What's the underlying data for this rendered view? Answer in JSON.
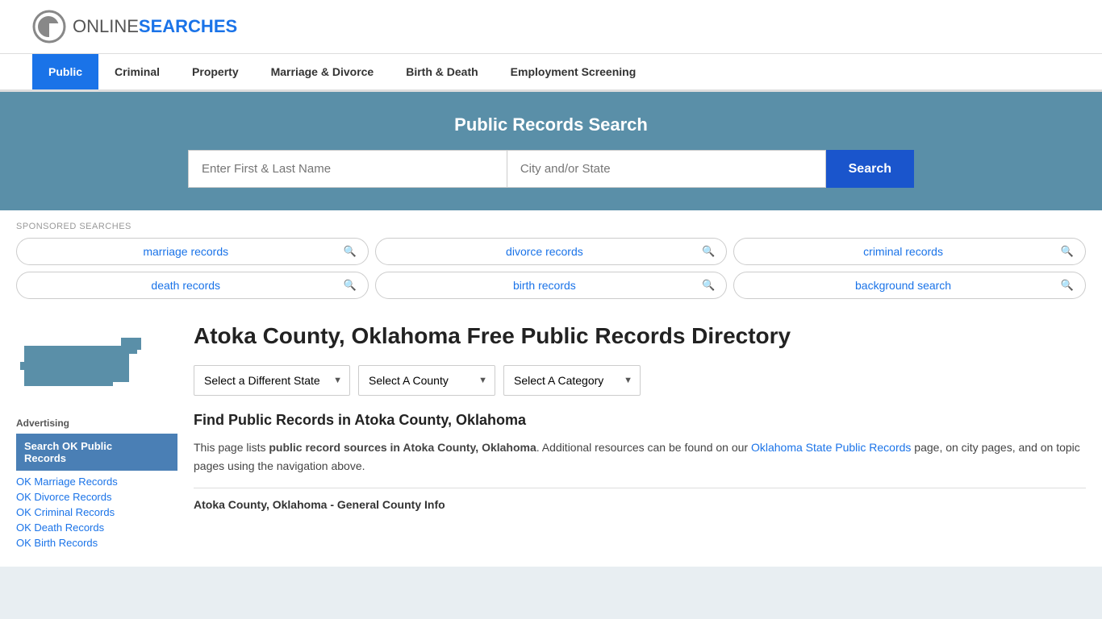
{
  "site": {
    "logo_text_normal": "ONLINE",
    "logo_text_bold": "SEARCHES"
  },
  "nav": {
    "items": [
      {
        "label": "Public",
        "active": true
      },
      {
        "label": "Criminal",
        "active": false
      },
      {
        "label": "Property",
        "active": false
      },
      {
        "label": "Marriage & Divorce",
        "active": false
      },
      {
        "label": "Birth & Death",
        "active": false
      },
      {
        "label": "Employment Screening",
        "active": false
      }
    ]
  },
  "hero": {
    "title": "Public Records Search",
    "name_placeholder": "Enter First & Last Name",
    "location_placeholder": "City and/or State",
    "search_button": "Search"
  },
  "sponsored": {
    "label": "SPONSORED SEARCHES",
    "items": [
      {
        "text": "marriage records"
      },
      {
        "text": "divorce records"
      },
      {
        "text": "criminal records"
      },
      {
        "text": "death records"
      },
      {
        "text": "birth records"
      },
      {
        "text": "background search"
      }
    ]
  },
  "page": {
    "title": "Atoka County, Oklahoma Free Public Records Directory",
    "selects": {
      "state": {
        "label": "Select a Different State",
        "options": [
          "Select a Different State"
        ]
      },
      "county": {
        "label": "Select A County",
        "options": [
          "Select A County"
        ]
      },
      "category": {
        "label": "Select A Category",
        "options": [
          "Select A Category"
        ]
      }
    },
    "section_heading": "Find Public Records in Atoka County, Oklahoma",
    "description_part1": "This page lists ",
    "description_bold": "public record sources in Atoka County, Oklahoma",
    "description_part2": ". Additional resources can be found on our ",
    "description_link_text": "Oklahoma State Public Records",
    "description_part3": " page, on city pages, and on topic pages using the navigation above.",
    "general_info_label": "Atoka County, Oklahoma - General County Info"
  },
  "sidebar": {
    "ad_label": "Advertising",
    "featured": {
      "line1": "Search OK Public",
      "line2": "Records"
    },
    "links": [
      "OK Marriage Records",
      "OK Divorce Records",
      "OK Criminal Records",
      "OK Death Records",
      "OK Birth Records"
    ]
  }
}
